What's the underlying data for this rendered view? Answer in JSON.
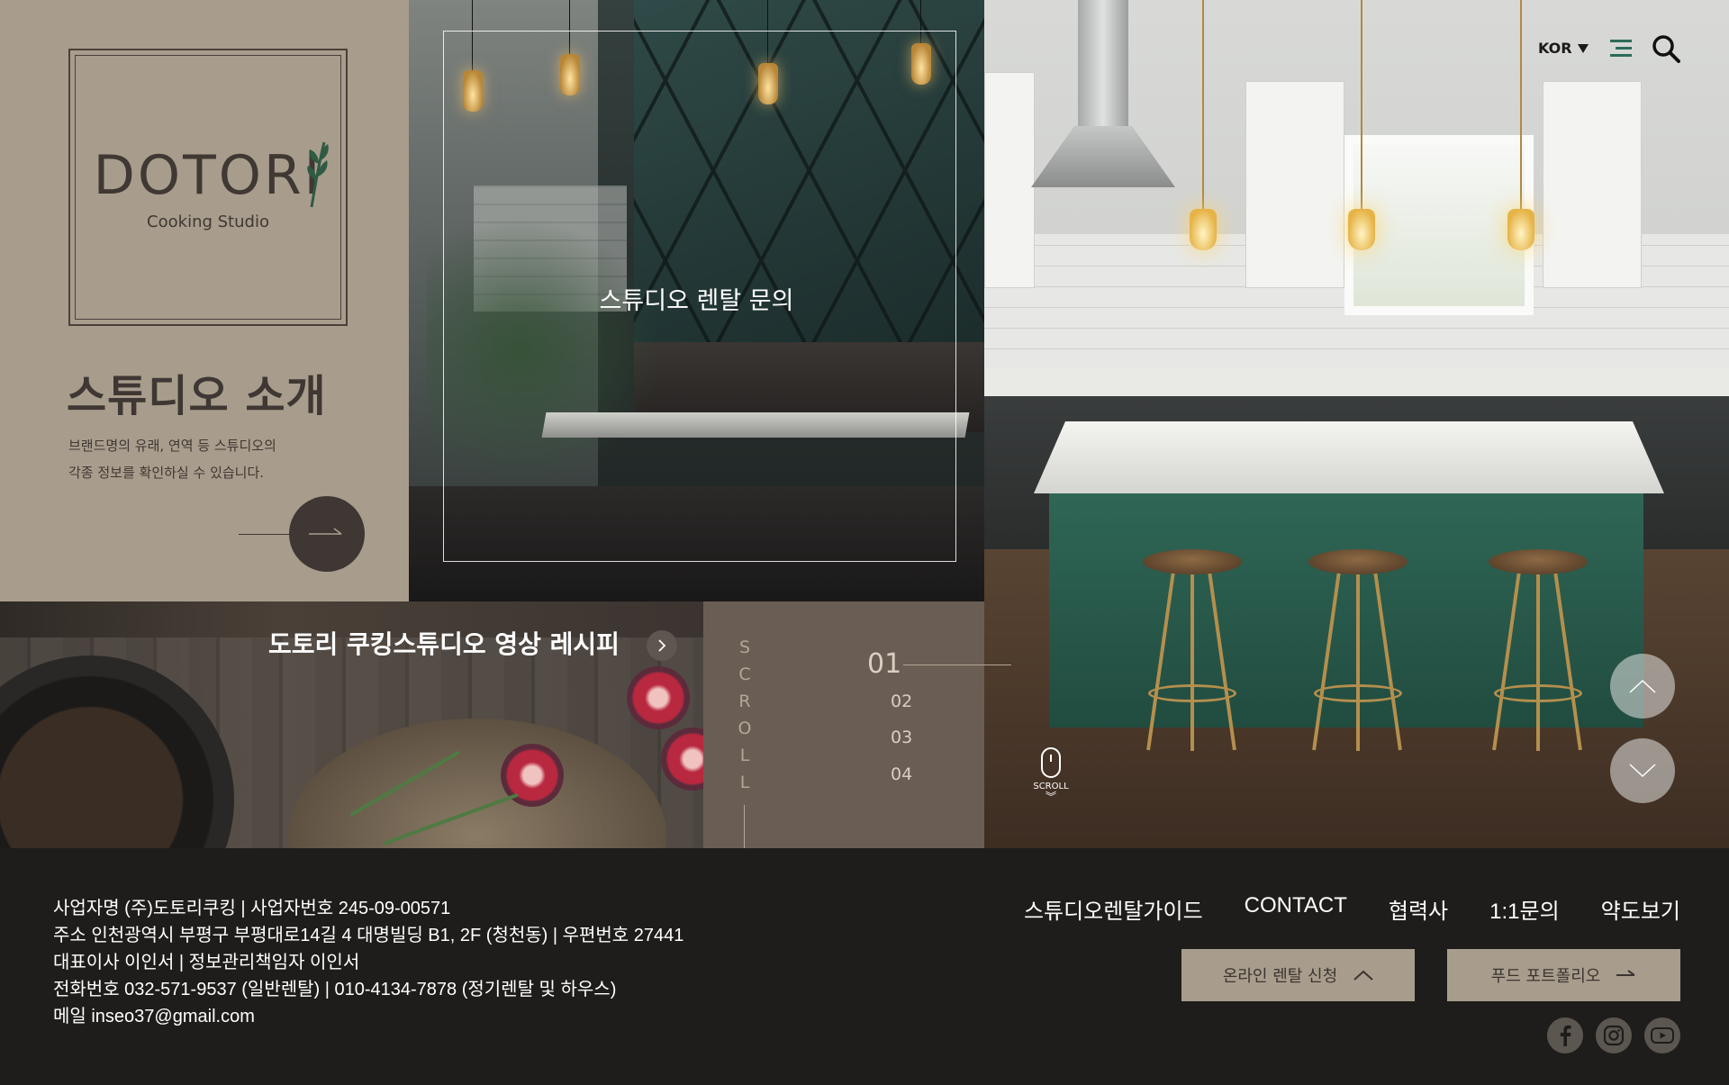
{
  "brand": {
    "logo_text": "DOTORI",
    "logo_sub": "Cooking Studio"
  },
  "intro": {
    "title": "스튜디오 소개",
    "desc_line1": "브랜드명의 유래, 연역 등 스튜디오의",
    "desc_line2": "각종 정보를 확인하실 수 있습니다."
  },
  "rental": {
    "title": "스튜디오 렌탈 문의"
  },
  "recipe": {
    "title": "도토리 쿠킹스튜디오 영상 레시피"
  },
  "pager": {
    "scroll_letters": [
      "S",
      "C",
      "R",
      "O",
      "L",
      "L"
    ],
    "current": "01",
    "pages": [
      "02",
      "03",
      "04"
    ]
  },
  "header": {
    "language": "KOR"
  },
  "mouse_hint": {
    "label": "SCROLL"
  },
  "footer": {
    "company_lines": [
      "사업자명  (주)도토리쿠킹  |  사업자번호  245-09-00571",
      "주소  인천광역시 부평구 부평대로14길 4 대명빌딩 B1, 2F (청천동)  |  우편번호  27441",
      "대표이사  이인서  |  정보관리책임자  이인서",
      "전화번호  032-571-9537 (일반렌탈)  |  010-4134-7878 (정기렌탈 및 하우스)",
      "메일  inseo37@gmail.com"
    ],
    "nav": [
      "스튜디오렌탈가이드",
      "CONTACT",
      "협력사",
      "1:1문의",
      "약도보기"
    ],
    "cta_online": "온라인 렌탈 신청",
    "cta_portfolio": "푸드 포트폴리오"
  },
  "icons": {
    "menu": "menu-icon",
    "search": "search-icon",
    "arrow": "arrow-right-icon",
    "up": "chevron-up-icon",
    "down": "chevron-down-icon",
    "facebook": "facebook-icon",
    "instagram": "instagram-icon",
    "youtube": "youtube-icon"
  },
  "colors": {
    "beige": "#a89d8c",
    "dark_brown": "#3f3733",
    "pager_brown": "#6a5e54",
    "footer_bg": "#1e1d1b",
    "accent_green": "#2e6b58"
  }
}
